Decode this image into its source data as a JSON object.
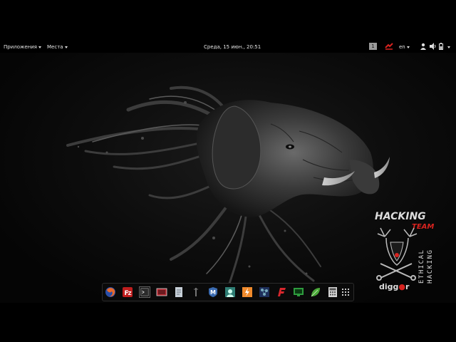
{
  "topbar": {
    "applications_label": "Приложения",
    "places_label": "Места",
    "clock": "Среда, 15 июн., 20:51",
    "workspace_number": "1",
    "keyboard_layout": "en"
  },
  "dock": {
    "items": [
      {
        "icon": "firefox-icon",
        "color": "#e8692c"
      },
      {
        "icon": "filezilla-icon",
        "color": "#bf1e1e"
      },
      {
        "icon": "terminal-icon",
        "color": "#555555"
      },
      {
        "icon": "image-viewer-icon",
        "color": "#b3262f"
      },
      {
        "icon": "text-editor-icon",
        "color": "#c7d0d8"
      },
      {
        "icon": "tool-icon",
        "color": "#444444"
      },
      {
        "icon": "metasploit-icon",
        "color": "#3a6ab0"
      },
      {
        "icon": "armitage-icon",
        "color": "#2e7d74"
      },
      {
        "icon": "burp-icon",
        "color": "#f08a2c"
      },
      {
        "icon": "maltego-icon",
        "color": "#3f5e9e"
      },
      {
        "icon": "faraday-icon",
        "color": "#d8272d"
      },
      {
        "icon": "monitor-icon",
        "color": "#2e9c3e"
      },
      {
        "icon": "leaf-icon",
        "color": "#4ba83a"
      },
      {
        "icon": "calculator-icon",
        "color": "#d5d5d5"
      },
      {
        "icon": "app-grid-icon",
        "color": "#cccccc"
      }
    ]
  },
  "logo": {
    "line1": "HACKING",
    "line2": "TEAM",
    "vertical1": "ETHICAL",
    "vertical2": "HACKING",
    "brand": "digg",
    "brand_suffix": "r",
    "accent": "#d8231f"
  },
  "colors": {
    "panel": "#000000",
    "text": "#e6e6e6"
  }
}
